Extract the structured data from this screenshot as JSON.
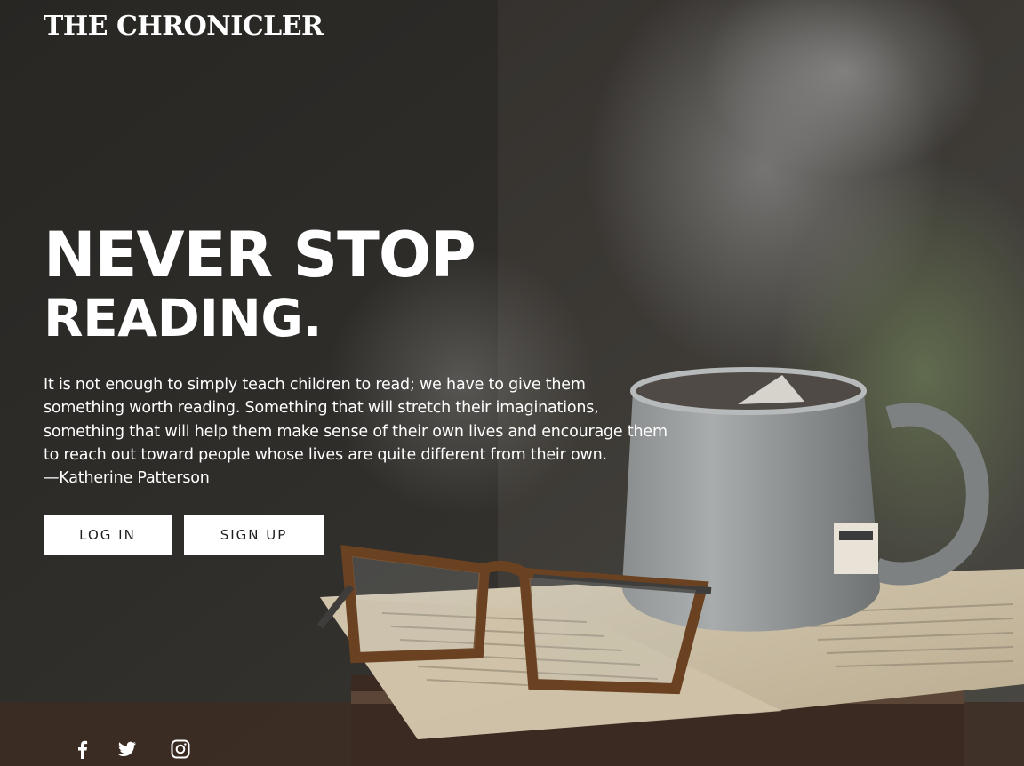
{
  "brand": {
    "name": "THE CHRONICLER"
  },
  "hero": {
    "headline_line1": "NEVER STOP",
    "headline_line2": "READING.",
    "quote": "It is not enough to simply teach children to read; we have to give them something worth reading. Something that will stretch their imaginations, something that will help them make sense of their own lives and encourage them to reach out toward people whose lives are quite different from their own.",
    "author": "—Katherine Patterson"
  },
  "actions": {
    "login_label": "LOG IN",
    "signup_label": "SIGN UP"
  },
  "social": {
    "icons": [
      "facebook-icon",
      "twitter-icon",
      "instagram-icon"
    ]
  },
  "colors": {
    "text": "#ffffff",
    "button_bg": "#ffffff",
    "button_text": "#1e1e1e"
  }
}
